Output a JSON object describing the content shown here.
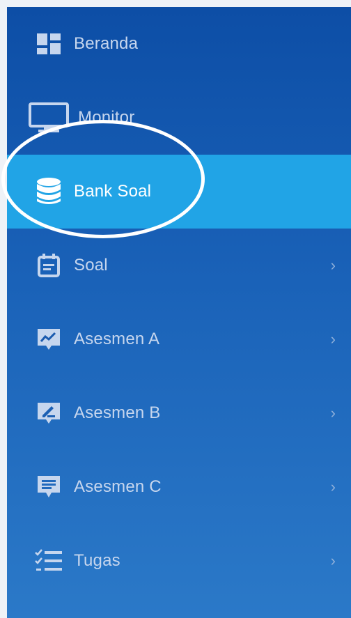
{
  "menu": {
    "items": [
      {
        "label": "Beranda",
        "icon": "dashboard-icon",
        "has_submenu": false
      },
      {
        "label": "Monitor",
        "icon": "monitor-icon",
        "has_submenu": false
      },
      {
        "label": "Bank Soal",
        "icon": "database-icon",
        "has_submenu": false,
        "active": true
      },
      {
        "label": "Soal",
        "icon": "calendar-icon",
        "has_submenu": true
      },
      {
        "label": "Asesmen A",
        "icon": "chart-comment-icon",
        "has_submenu": true
      },
      {
        "label": "Asesmen B",
        "icon": "edit-comment-icon",
        "has_submenu": true
      },
      {
        "label": "Asesmen C",
        "icon": "message-text-icon",
        "has_submenu": true
      },
      {
        "label": "Tugas",
        "icon": "checklist-icon",
        "has_submenu": true
      }
    ],
    "chevron": "›"
  },
  "colors": {
    "sidebar_top": "#0d4ea6",
    "sidebar_bottom": "#2b79c8",
    "active_bg": "#21a4e6",
    "label": "#c6d6ee",
    "active_label": "#ffffff",
    "icon": "#c6d6ee"
  }
}
